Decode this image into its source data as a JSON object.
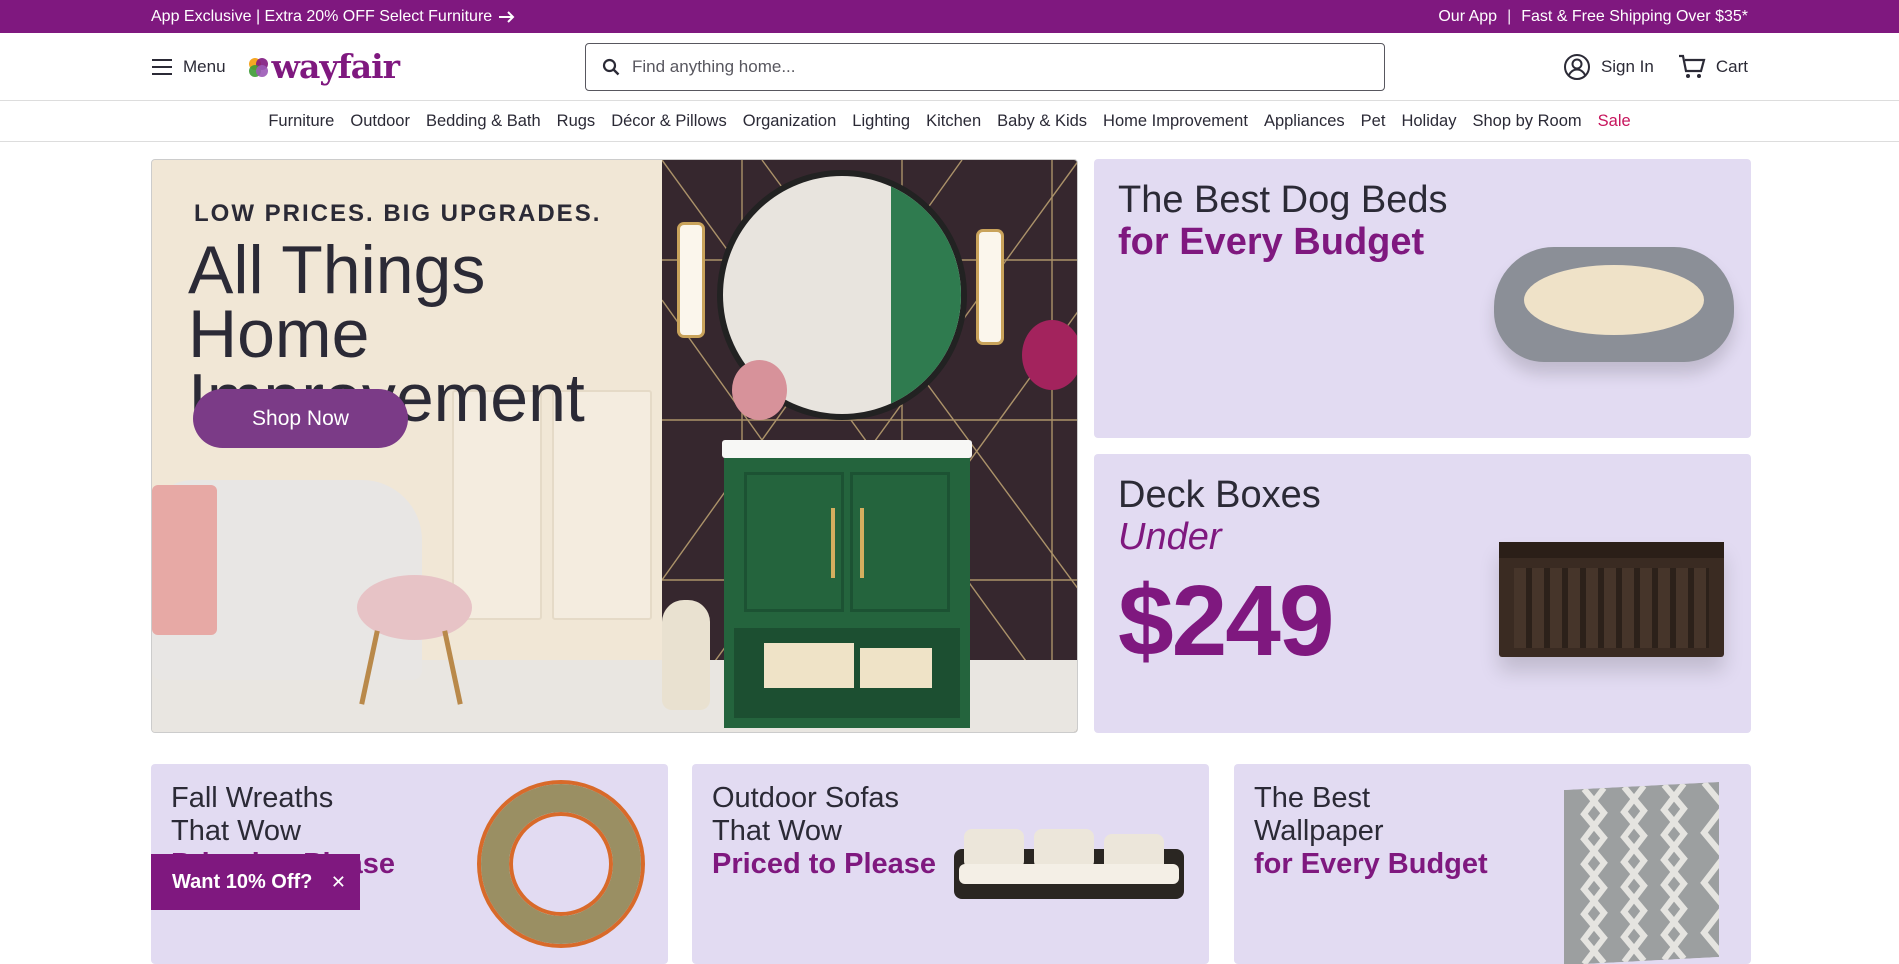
{
  "promo": {
    "left_text": "App Exclusive | Extra 20% OFF Select Furniture",
    "right_app": "Our App",
    "separator": "|",
    "right_shipping": "Fast & Free Shipping Over $35*"
  },
  "header": {
    "menu_label": "Menu",
    "logo_text": "wayfair",
    "search_placeholder": "Find anything home...",
    "sign_in": "Sign In",
    "cart": "Cart"
  },
  "nav": {
    "items": [
      "Furniture",
      "Outdoor",
      "Bedding & Bath",
      "Rugs",
      "Décor & Pillows",
      "Organization",
      "Lighting",
      "Kitchen",
      "Baby & Kids",
      "Home Improvement",
      "Appliances",
      "Pet",
      "Holiday",
      "Shop by Room",
      "Sale"
    ]
  },
  "hero": {
    "kicker": "LOW PRICES. BIG UPGRADES.",
    "title": "All Things Home Improvement",
    "cta": "Shop Now"
  },
  "cards": {
    "dog_beds": {
      "line1": "The Best Dog Beds",
      "line2": "for Every Budget"
    },
    "deck_boxes": {
      "line1": "Deck Boxes",
      "line2": "Under",
      "price": "$249"
    }
  },
  "bottom": {
    "wreaths": {
      "line1": "Fall Wreaths",
      "line2": "That Wow",
      "line3": "Priced to Please"
    },
    "sofas": {
      "line1": "Outdoor Sofas",
      "line2": "That Wow",
      "line3": "Priced to Please"
    },
    "wallpaper": {
      "line1": "The Best",
      "line2": "Wallpaper",
      "line3": "for Every Budget"
    }
  },
  "offer": {
    "label": "Want 10% Off?",
    "close": "✕"
  },
  "colors": {
    "brand": "#7f187f",
    "card_bg": "#e2dbf2",
    "sale": "#c7155d",
    "cta": "#7b3b87"
  }
}
